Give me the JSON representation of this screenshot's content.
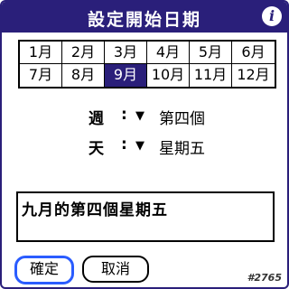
{
  "dialog": {
    "title": "設定開始日期",
    "info_icon_glyph": "i"
  },
  "months": [
    {
      "label": "1月",
      "selected": false
    },
    {
      "label": "2月",
      "selected": false
    },
    {
      "label": "3月",
      "selected": false
    },
    {
      "label": "4月",
      "selected": false
    },
    {
      "label": "5月",
      "selected": false
    },
    {
      "label": "6月",
      "selected": false
    },
    {
      "label": "7月",
      "selected": false
    },
    {
      "label": "8月",
      "selected": false
    },
    {
      "label": "9月",
      "selected": true
    },
    {
      "label": "10月",
      "selected": false
    },
    {
      "label": "11月",
      "selected": false
    },
    {
      "label": "12月",
      "selected": false
    }
  ],
  "week_field": {
    "label": "週",
    "colon": ":",
    "arrow": "▼",
    "value": "第四個"
  },
  "day_field": {
    "label": "天",
    "colon": ":",
    "arrow": "▼",
    "value": "星期五"
  },
  "result": {
    "text": "九月的第四個星期五"
  },
  "buttons": {
    "ok": "確定",
    "cancel": "取消"
  },
  "watermark": "#2765",
  "colors": {
    "title_bar": "#2a1f7a",
    "selected_month": "#2a1f7a",
    "focus_outline": "#2a5cff"
  }
}
